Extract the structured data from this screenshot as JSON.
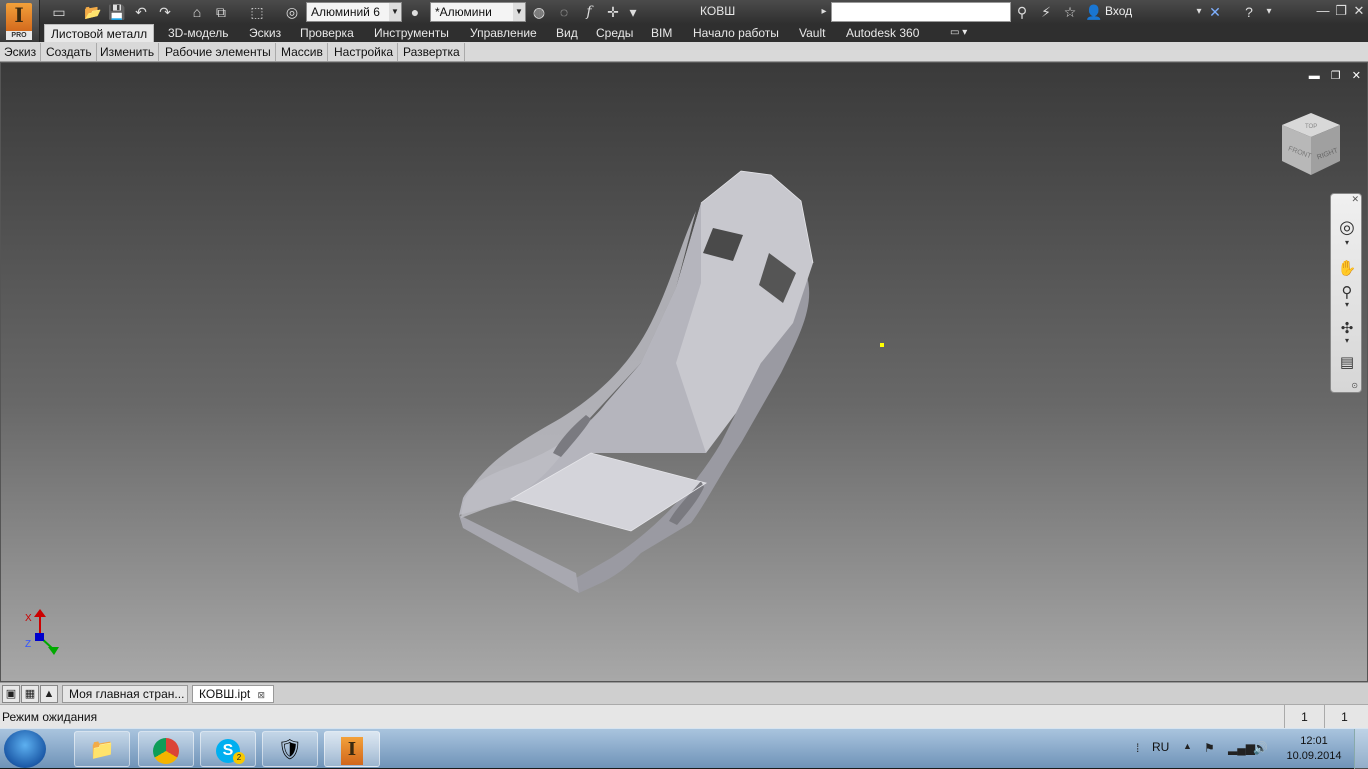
{
  "app": {
    "logo_letter": "I",
    "logo_sub": "PRO",
    "document_title": "КОВШ",
    "signin_label": "Вход",
    "material_combo": "Алюминий 6",
    "appearance_combo": "*Алюмини"
  },
  "ribbon_tabs": [
    {
      "label": "Листовой металл"
    },
    {
      "label": "3D-модель"
    },
    {
      "label": "Эскиз"
    },
    {
      "label": "Проверка"
    },
    {
      "label": "Инструменты"
    },
    {
      "label": "Управление"
    },
    {
      "label": "Вид"
    },
    {
      "label": "Среды"
    },
    {
      "label": "BIM"
    },
    {
      "label": "Начало работы"
    },
    {
      "label": "Vault"
    },
    {
      "label": "Autodesk 360"
    }
  ],
  "panels": [
    {
      "label": "Эскиз"
    },
    {
      "label": "Создать"
    },
    {
      "label": "Изменить"
    },
    {
      "label": "Рабочие элементы"
    },
    {
      "label": "Массив"
    },
    {
      "label": "Настройка"
    },
    {
      "label": "Развертка"
    }
  ],
  "viewcube": {
    "face_front": "FRONT",
    "face_right": "RIGHT",
    "face_top": "TOP"
  },
  "triad": {
    "x": "X",
    "z": "Z"
  },
  "doc_tabs": [
    {
      "label": "Моя главная стран..."
    },
    {
      "label": "КОВШ.ipt"
    }
  ],
  "status": {
    "text": "Режим ожидания",
    "count_1": "1",
    "count_2": "1"
  },
  "taskbar": {
    "lang": "RU",
    "time": "12:01",
    "date": "10.09.2014",
    "skype_badge": "2"
  },
  "colors": {
    "accent": "#d1661b",
    "selection": "#ffff00"
  }
}
